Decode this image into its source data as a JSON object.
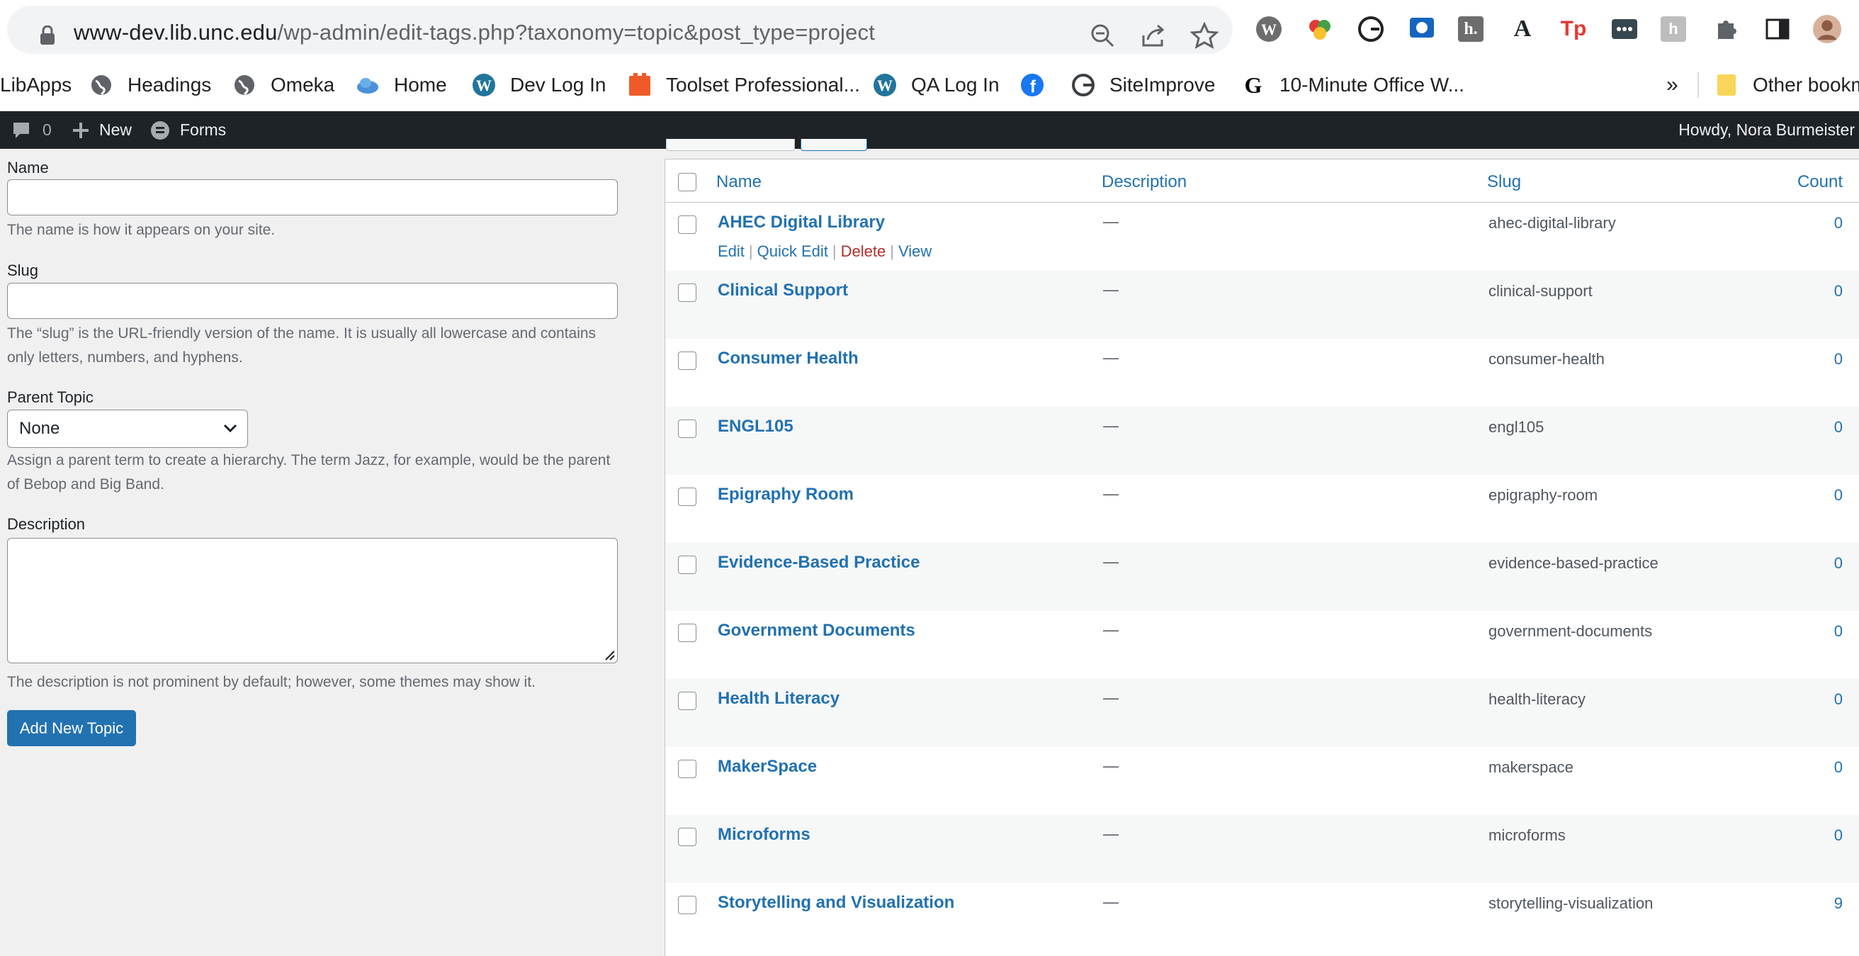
{
  "browser": {
    "url_host": "www-dev.lib.unc.edu",
    "url_path": "/wp-admin/edit-tags.php?taxonomy=topic&post_type=project",
    "bookmarks": [
      "LibApps",
      "Headings",
      "Omeka",
      "Home",
      "Dev Log In",
      "Toolset Professional...",
      "QA Log In",
      "",
      "SiteImprove",
      "10-Minute Office W..."
    ],
    "overflow": "»",
    "other_bookmarks": "Other bookm"
  },
  "adminbar": {
    "comments_count": "0",
    "new_label": "New",
    "forms_label": "Forms",
    "howdy": "Howdy, Nora Burmeister"
  },
  "form": {
    "name_label": "Name",
    "name_help": "The name is how it appears on your site.",
    "slug_label": "Slug",
    "slug_help": "The “slug” is the URL-friendly version of the name. It is usually all lowercase and contains only letters, numbers, and hyphens.",
    "parent_label": "Parent Topic",
    "parent_value": "None",
    "parent_help": "Assign a parent term to create a hierarchy. The term Jazz, for example, would be the parent of Bebop and Big Band.",
    "desc_label": "Description",
    "desc_help": "The description is not prominent by default; however, some themes may show it.",
    "submit_label": "Add New Topic"
  },
  "table": {
    "columns": [
      "Name",
      "Description",
      "Slug",
      "Count"
    ],
    "row_actions": {
      "edit": "Edit",
      "quick_edit": "Quick Edit",
      "delete": "Delete",
      "view": "View"
    },
    "rows": [
      {
        "name": "AHEC Digital Library",
        "desc": "—",
        "slug": "ahec-digital-library",
        "count": "0"
      },
      {
        "name": "Clinical Support",
        "desc": "—",
        "slug": "clinical-support",
        "count": "0"
      },
      {
        "name": "Consumer Health",
        "desc": "—",
        "slug": "consumer-health",
        "count": "0"
      },
      {
        "name": "ENGL105",
        "desc": "—",
        "slug": "engl105",
        "count": "0"
      },
      {
        "name": "Epigraphy Room",
        "desc": "—",
        "slug": "epigraphy-room",
        "count": "0"
      },
      {
        "name": "Evidence-Based Practice",
        "desc": "—",
        "slug": "evidence-based-practice",
        "count": "0"
      },
      {
        "name": "Government Documents",
        "desc": "—",
        "slug": "government-documents",
        "count": "0"
      },
      {
        "name": "Health Literacy",
        "desc": "—",
        "slug": "health-literacy",
        "count": "0"
      },
      {
        "name": "MakerSpace",
        "desc": "—",
        "slug": "makerspace",
        "count": "0"
      },
      {
        "name": "Microforms",
        "desc": "—",
        "slug": "microforms",
        "count": "0"
      },
      {
        "name": "Storytelling and Visualization",
        "desc": "—",
        "slug": "storytelling-visualization",
        "count": "9"
      }
    ]
  }
}
